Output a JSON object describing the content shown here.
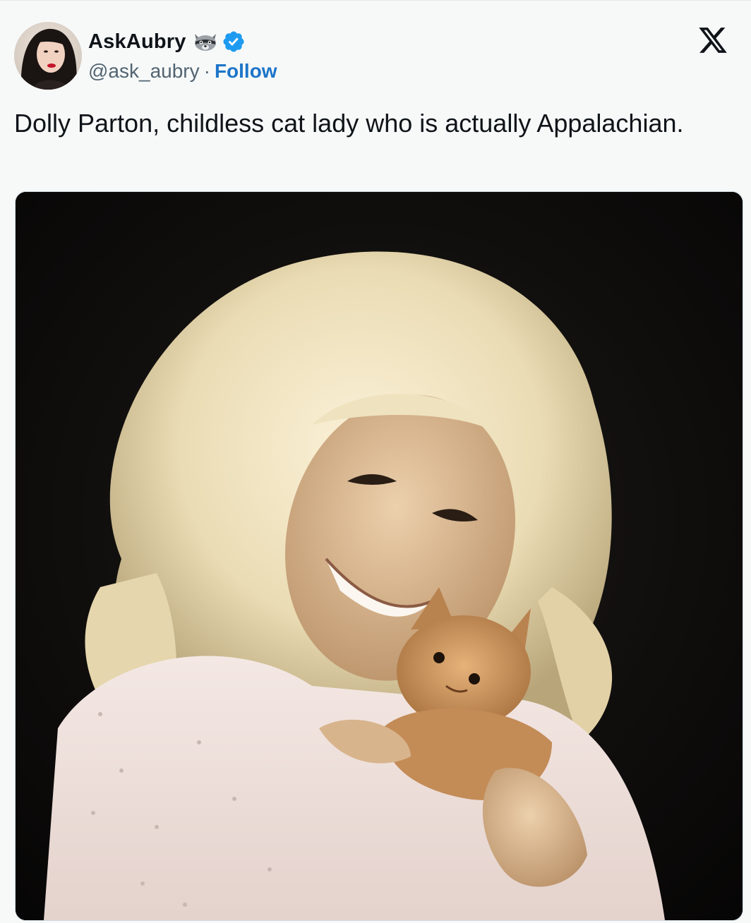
{
  "tweet": {
    "author": {
      "display_name": "AskAubry",
      "handle": "@ask_aubry",
      "emoji": "raccoon-emoji",
      "verified": true,
      "avatar": "avatar-photo"
    },
    "separator": "·",
    "follow_label": "Follow",
    "text": "Dolly Parton, childless cat lady who is actually Appalachian.",
    "media": {
      "type": "photo"
    }
  },
  "icons": {
    "platform_logo": "x-logo-icon",
    "verified": "verified-badge-icon"
  },
  "colors": {
    "link": "#1d75c9",
    "verified": "#1d9bf0",
    "text": "#0f1419",
    "muted": "#536471",
    "background": "#f7f9f9"
  }
}
